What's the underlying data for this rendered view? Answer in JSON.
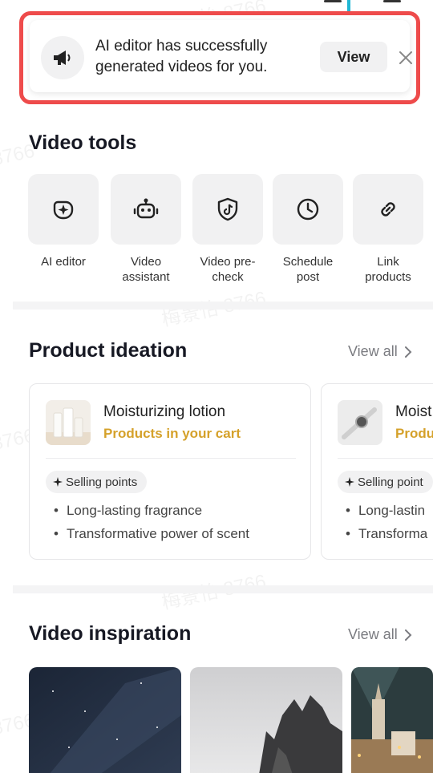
{
  "notification": {
    "message": "AI editor has successfully generated videos for you.",
    "view_label": "View",
    "icon": "megaphone-icon"
  },
  "video_tools": {
    "title": "Video tools",
    "items": [
      {
        "label": "AI editor",
        "icon": "ai-sparkle-icon"
      },
      {
        "label": "Video assistant",
        "icon": "robot-icon"
      },
      {
        "label": "Video pre-check",
        "icon": "shield-check-icon"
      },
      {
        "label": "Schedule post",
        "icon": "clock-icon"
      },
      {
        "label": "Link products",
        "icon": "link-icon"
      }
    ]
  },
  "product_ideation": {
    "title": "Product ideation",
    "view_all": "View all",
    "cards": [
      {
        "name": "Moisturizing lotion",
        "subtitle": "Products in your cart",
        "chip": "Selling points",
        "points": [
          "Long-lasting fragrance",
          "Transformative power of scent"
        ]
      },
      {
        "name": "Moist",
        "subtitle": "Produ",
        "chip": "Selling point",
        "points": [
          "Long-lastin",
          "Transforma"
        ]
      }
    ]
  },
  "video_inspiration": {
    "title": "Video inspiration",
    "view_all": "View all"
  },
  "colors": {
    "accent_gold": "#d5a12a",
    "highlight_border": "#ee4b4b",
    "tile_bg": "#f1f1f2"
  }
}
